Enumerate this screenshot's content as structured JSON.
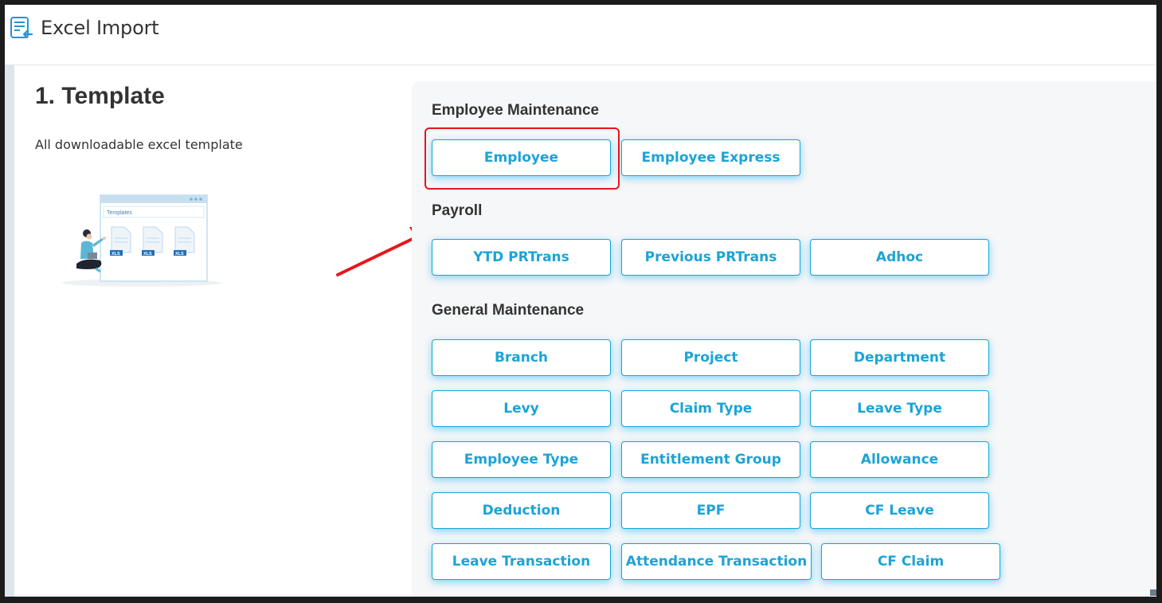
{
  "header": {
    "title": "Excel Import",
    "icon": "excel-import-icon"
  },
  "template": {
    "title": "1. Template",
    "description": "All downloadable excel template",
    "illustration": {
      "heading": "Templates",
      "file_label": "XLS"
    }
  },
  "groups": {
    "employee_maintenance": {
      "title": "Employee Maintenance",
      "buttons": [
        "Employee",
        "Employee Express"
      ]
    },
    "payroll": {
      "title": "Payroll",
      "buttons": [
        "YTD PRTrans",
        "Previous PRTrans",
        "Adhoc"
      ]
    },
    "general_maintenance": {
      "title": "General Maintenance",
      "buttons": [
        "Branch",
        "Project",
        "Department",
        "Levy",
        "Claim Type",
        "Leave Type",
        "Employee Type",
        "Entitlement Group",
        "Allowance",
        "Deduction",
        "EPF",
        "CF Leave",
        "Leave Transaction",
        "Attendance Transaction",
        "CF Claim"
      ]
    }
  },
  "colors": {
    "accent": "#1ca3d6",
    "highlight": "#e8141c",
    "panel": "#f6f7f8"
  }
}
